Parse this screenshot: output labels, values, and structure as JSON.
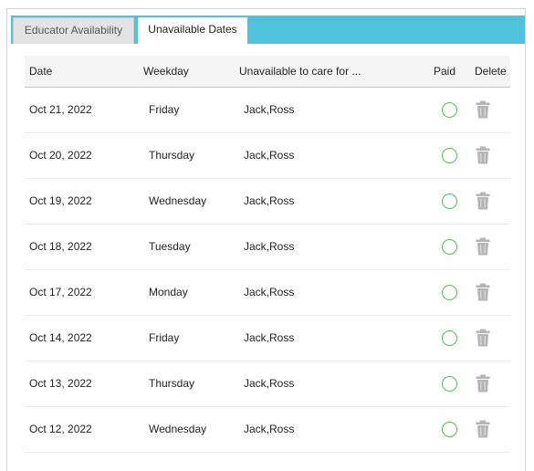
{
  "tabs": [
    {
      "label": "Educator Availability",
      "active": false
    },
    {
      "label": "Unavailable Dates",
      "active": true
    }
  ],
  "table": {
    "headers": {
      "date": "Date",
      "weekday": "Weekday",
      "unavailable": "Unavailable to care for ...",
      "paid": "Paid",
      "delete": "Delete"
    },
    "rows": [
      {
        "date": "Oct 21, 2022",
        "weekday": "Friday",
        "children": "Jack,Ross",
        "paid": false
      },
      {
        "date": "Oct 20, 2022",
        "weekday": "Thursday",
        "children": "Jack,Ross",
        "paid": false
      },
      {
        "date": "Oct 19, 2022",
        "weekday": "Wednesday",
        "children": "Jack,Ross",
        "paid": false
      },
      {
        "date": "Oct 18, 2022",
        "weekday": "Tuesday",
        "children": "Jack,Ross",
        "paid": false
      },
      {
        "date": "Oct 17, 2022",
        "weekday": "Monday",
        "children": "Jack,Ross",
        "paid": false
      },
      {
        "date": "Oct 14, 2022",
        "weekday": "Friday",
        "children": "Jack,Ross",
        "paid": false
      },
      {
        "date": "Oct 13, 2022",
        "weekday": "Thursday",
        "children": "Jack,Ross",
        "paid": false
      },
      {
        "date": "Oct 12, 2022",
        "weekday": "Wednesday",
        "children": "Jack,Ross",
        "paid": false
      }
    ]
  },
  "colors": {
    "tab_bar": "#4fc3db",
    "paid_radio": "#5cb85c",
    "trash_icon": "#b5b5b5"
  },
  "icons": {
    "paid": "radio-circle-icon",
    "delete": "trash-icon"
  }
}
